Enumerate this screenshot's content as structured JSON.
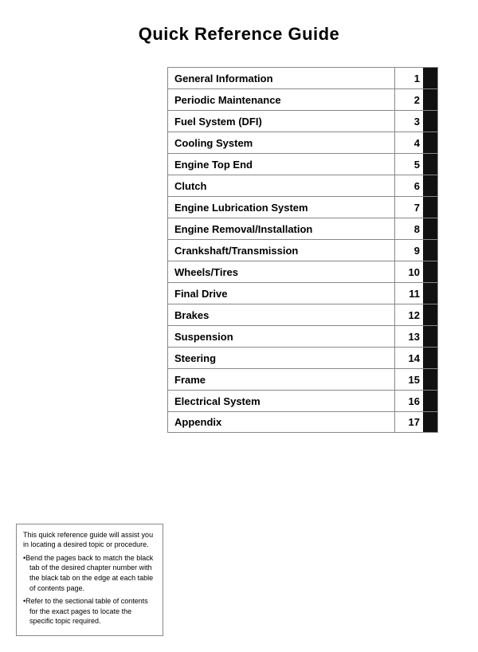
{
  "title": "Quick Reference Guide",
  "toc": {
    "items": [
      {
        "label": "General Information",
        "number": 1
      },
      {
        "label": "Periodic Maintenance",
        "number": 2
      },
      {
        "label": "Fuel System (DFI)",
        "number": 3
      },
      {
        "label": "Cooling System",
        "number": 4
      },
      {
        "label": "Engine Top End",
        "number": 5
      },
      {
        "label": "Clutch",
        "number": 6
      },
      {
        "label": "Engine Lubrication System",
        "number": 7
      },
      {
        "label": "Engine Removal/Installation",
        "number": 8
      },
      {
        "label": "Crankshaft/Transmission",
        "number": 9
      },
      {
        "label": "Wheels/Tires",
        "number": 10
      },
      {
        "label": "Final Drive",
        "number": 11
      },
      {
        "label": "Brakes",
        "number": 12
      },
      {
        "label": "Suspension",
        "number": 13
      },
      {
        "label": "Steering",
        "number": 14
      },
      {
        "label": "Frame",
        "number": 15
      },
      {
        "label": "Electrical System",
        "number": 16
      },
      {
        "label": "Appendix",
        "number": 17
      }
    ]
  },
  "note": {
    "line1": "This quick reference guide will assist you in locating a desired topic or procedure.",
    "bullet1": "•Bend the pages back to match the black tab of the desired chapter number with the black tab on the edge at each table of contents page.",
    "bullet2": "•Refer to the sectional table of contents for the exact pages to locate the specific topic required."
  }
}
